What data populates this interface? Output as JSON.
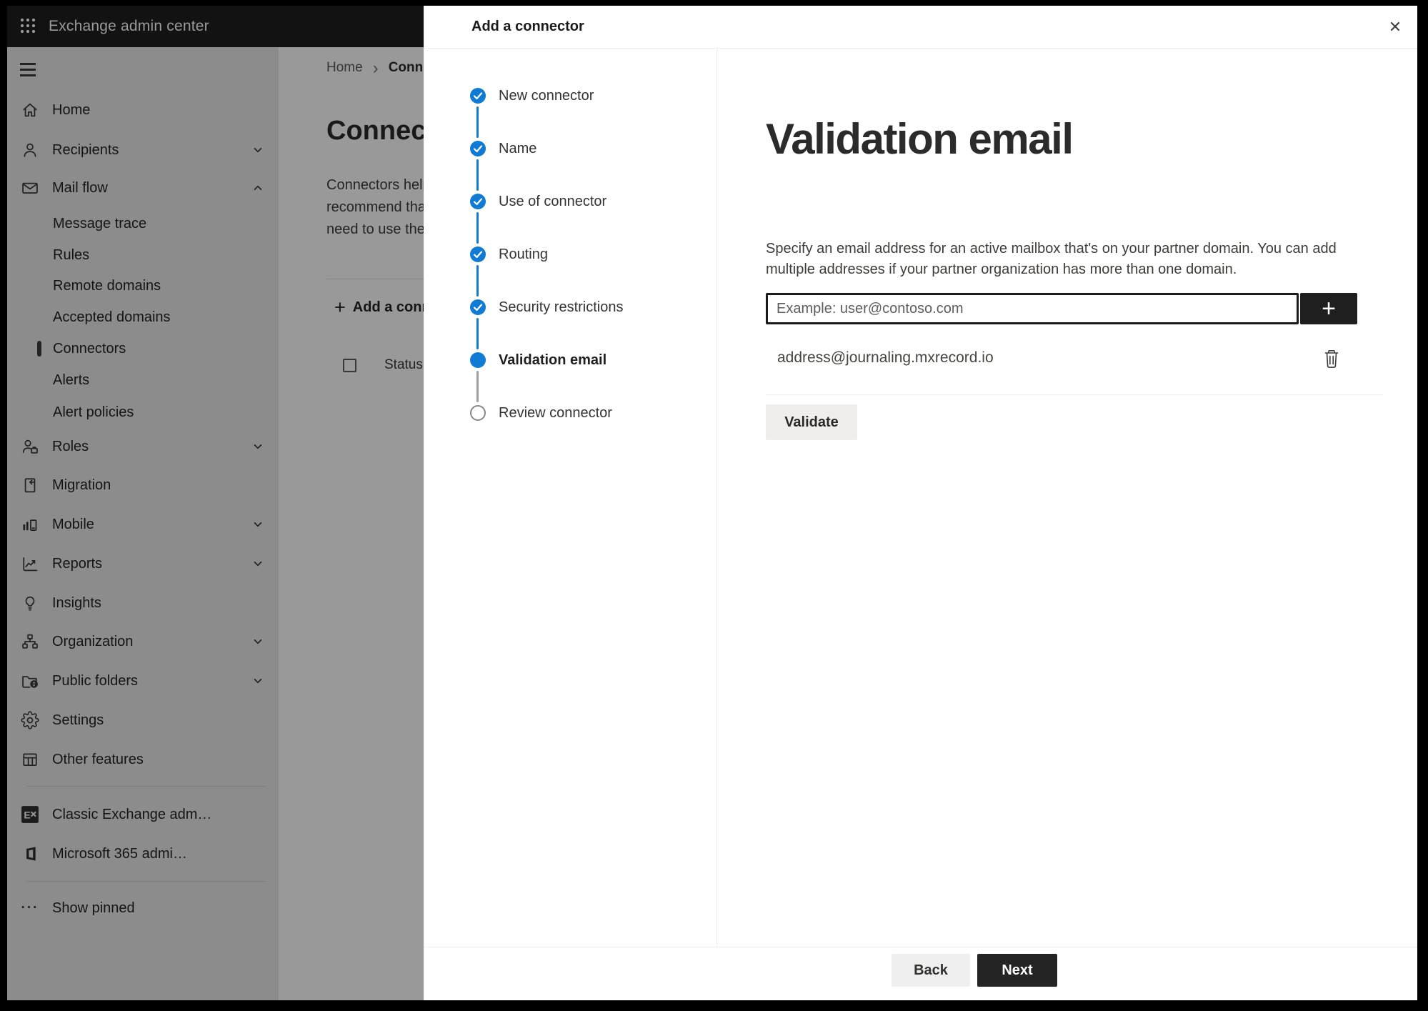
{
  "colors": {
    "step_accent_blue": "#0F7BD4",
    "primary_button_bg": "#242424",
    "topbar_bg": "#1F1F1F",
    "sidebar_bg": "#EAEAEA",
    "overlay": "rgba(0,0,0,0.40)"
  },
  "icons": {
    "plus": "+",
    "close": "✕",
    "ellipsis": "···",
    "breadcrumb_chevron": "›"
  },
  "topbar": {
    "title": "Exchange admin center"
  },
  "sidebar": {
    "items": [
      {
        "label": "Home"
      },
      {
        "label": "Recipients",
        "chevron": "down"
      },
      {
        "label": "Mail flow",
        "chevron": "up"
      },
      {
        "label": "Message trace"
      },
      {
        "label": "Rules"
      },
      {
        "label": "Remote domains"
      },
      {
        "label": "Accepted domains"
      },
      {
        "label": "Connectors",
        "selected": true
      },
      {
        "label": "Alerts"
      },
      {
        "label": "Alert policies"
      },
      {
        "label": "Roles",
        "chevron": "down"
      },
      {
        "label": "Migration"
      },
      {
        "label": "Mobile",
        "chevron": "down"
      },
      {
        "label": "Reports",
        "chevron": "down"
      },
      {
        "label": "Insights"
      },
      {
        "label": "Organization",
        "chevron": "down"
      },
      {
        "label": "Public folders",
        "chevron": "down"
      },
      {
        "label": "Settings"
      },
      {
        "label": "Other features"
      }
    ],
    "footer_items": [
      {
        "label": "Classic Exchange adm…"
      },
      {
        "label": "Microsoft 365 admi…"
      }
    ],
    "show_pinned": "Show pinned"
  },
  "page": {
    "breadcrumb": {
      "home": "Home",
      "current": "Conne"
    },
    "title": "Connec",
    "intro_lines": [
      "Connectors help",
      "recommend that",
      "need to use ther"
    ],
    "add_connector_button": "Add a conn",
    "table": {
      "status_header": "Status"
    }
  },
  "wizard": {
    "title": "Add a connector",
    "steps": [
      {
        "label": "New connector",
        "state": "completed"
      },
      {
        "label": "Name",
        "state": "completed"
      },
      {
        "label": "Use of connector",
        "state": "completed"
      },
      {
        "label": "Routing",
        "state": "completed"
      },
      {
        "label": "Security restrictions",
        "state": "completed"
      },
      {
        "label": "Validation email",
        "state": "current"
      },
      {
        "label": "Review connector",
        "state": "upcoming"
      }
    ],
    "content": {
      "heading": "Validation email",
      "description": "Specify an email address for an active mailbox that's on your partner domain. You can add multiple addresses if your partner organization has more than one domain.",
      "email_placeholder": "Example: user@contoso.com",
      "email_value": "",
      "addresses": [
        {
          "email": "address@journaling.mxrecord.io"
        }
      ],
      "validate_button": "Validate"
    },
    "footer": {
      "back": "Back",
      "next": "Next"
    }
  }
}
